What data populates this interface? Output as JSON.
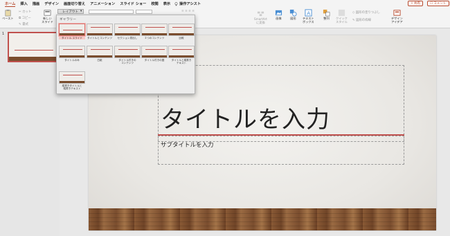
{
  "tabs": [
    "ホーム",
    "挿入",
    "描画",
    "デザイン",
    "画面切り替え",
    "アニメーション",
    "スライド ショー",
    "校閲",
    "表示"
  ],
  "active_tab": "ホーム",
  "tell_me": "操作アシスト",
  "share_label": "共有",
  "comment_label": "コメント",
  "ribbon": {
    "paste": "ペースト",
    "cut": "カット",
    "copy": "コピー",
    "format": "書式",
    "new_slide": "新しい\nスライド",
    "layout": "レイアウト",
    "smartart": "SmartArt\nに変換",
    "picture": "画像",
    "shape": "図形",
    "textbox": "テキスト\nボックス",
    "arrange": "整列",
    "quick_style": "クイック\nスタイル",
    "shape_fill": "図形の塗りつぶし",
    "shape_outline": "図形の枠線",
    "design_ideas": "デザイン\nアイデア"
  },
  "gallery": {
    "header": "ギャラリー",
    "items": [
      "タイトル スライド",
      "タイトルとコンテンツ",
      "セクション見出し",
      "２つのコンテンツ",
      "比較",
      "タイトルのみ",
      "白紙",
      "タイトル付きの\nコンテンツ",
      "タイトル付きの図",
      "タイトルと縦書き\nテキスト",
      "縦書きタイトルと\n縦書きテキスト"
    ],
    "selected_index": 0
  },
  "slide_number": "1",
  "slide": {
    "title": "タイトルを入力",
    "subtitle": "サブタイトルを入力"
  },
  "colors": {
    "accent": "#b7472a",
    "red_line": "#c0504d"
  }
}
